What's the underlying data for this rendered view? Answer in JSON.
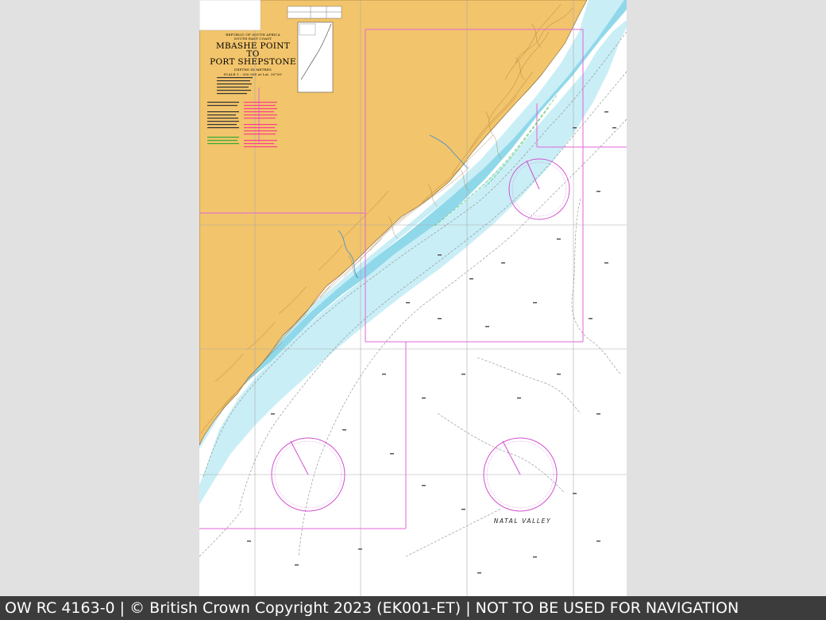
{
  "viewer": {
    "footer_text": "OW RC 4163-0 | © British Crown Copyright 2023 (EK001-ET) | NOT TO BE USED FOR NAVIGATION"
  },
  "chart": {
    "country": "REPUBLIC OF SOUTH AFRICA",
    "coast": "SOUTH EAST COAST",
    "title_line1": "MBASHE POINT",
    "title_line2": "TO",
    "title_line3": "PORT SHEPSTONE",
    "depths_note": "DEPTHS IN METRES",
    "scale_note": "SCALE 1 : 300 000 at Lat. 30°30'",
    "feature_label": "NATAL VALLEY",
    "colors": {
      "land": "#f2c46b",
      "shallow_water": "#c9eef6",
      "mid_water": "#8fd8ea",
      "deep_water": "#ffffff",
      "panel_border": "#e066d8",
      "compass": "#d050d0",
      "magenta_text": "#ff3d8b",
      "green_text": "#33aa33",
      "contour": "#888888",
      "footer_bg": "#3c3c3c",
      "viewer_bg": "#e1e1e1"
    },
    "icons": [
      "compass-rose",
      "compass-rose",
      "compass-rose",
      "location-inset-map"
    ]
  }
}
